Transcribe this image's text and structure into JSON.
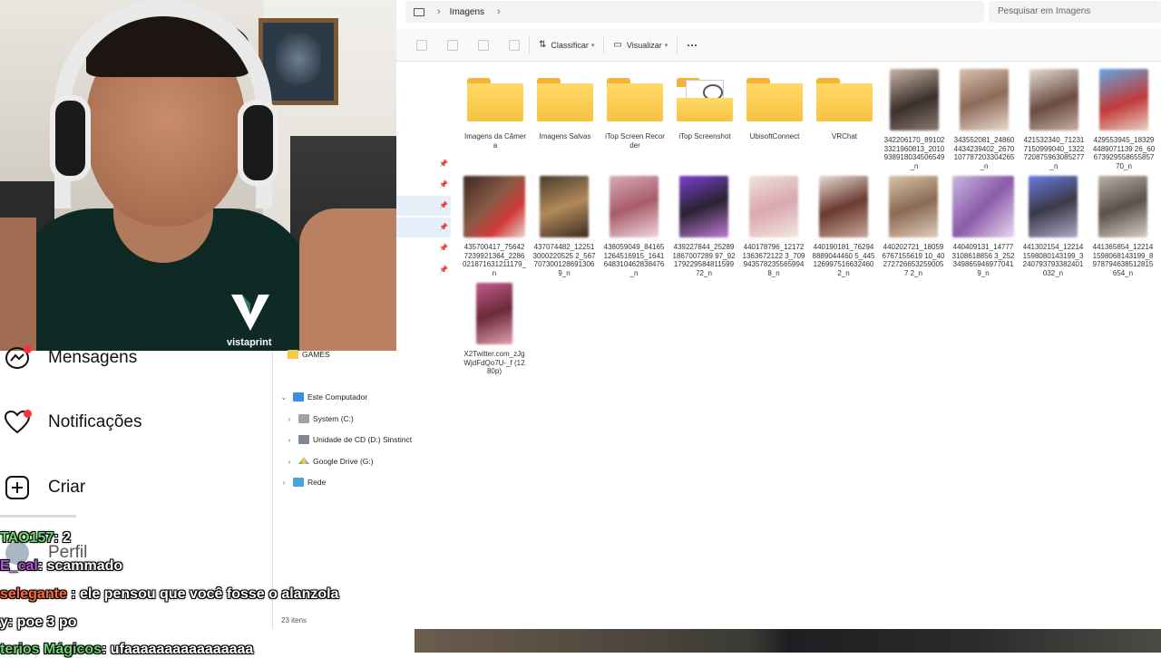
{
  "explorer": {
    "breadcrumb": "Imagens",
    "search_placeholder": "Pesquisar em Imagens",
    "toolbar": {
      "sort_label": "Classificar",
      "view_label": "Visualizar",
      "more_label": "···"
    },
    "status": "23 itens",
    "tree": [
      {
        "label": "GAMES",
        "icon": "folder-icon"
      },
      {
        "label": "Este Computador",
        "icon": "pc-icon",
        "expanded": true
      },
      {
        "label": "System  (C:)",
        "icon": "drive-icon"
      },
      {
        "label": "Unidade de CD (D:) Sinstinct",
        "icon": "cd-drive-icon"
      },
      {
        "label": "Google Drive (G:)",
        "icon": "google-drive-icon"
      },
      {
        "label": "Rede",
        "icon": "network-icon"
      }
    ],
    "folders": [
      {
        "name": "Imagens da Câmera"
      },
      {
        "name": "Imagens Salvas"
      },
      {
        "name": "iTop Screen Recorder"
      },
      {
        "name": "iTop Screenshot"
      },
      {
        "name": "UbisoftConnect"
      },
      {
        "name": "VRChat"
      }
    ],
    "files_row1": [
      {
        "name": "342206170_891023321960813_2010938918034506549_n"
      },
      {
        "name": "343552081_248604434239402_2670107787203304265_n"
      },
      {
        "name": "421532340_712317150999040_1322720875963085277_n"
      },
      {
        "name": "429553945_183294489071139 26_6067392955865585770_n"
      }
    ],
    "files_row2": [
      {
        "name": "435700417_756427239921364_2286021871631211179_n"
      },
      {
        "name": "437074482_122513000220525 2_567707300128691306 9_n"
      },
      {
        "name": "438059049_841651264516915_1641648310462838476_n"
      },
      {
        "name": "439227844_252891867007289 97_9217922958481159972_n"
      },
      {
        "name": "440178796_121721363672122 3_709943578235565994 8_n"
      },
      {
        "name": "440190181_762948889044460 5_445126997516632460 2_n"
      },
      {
        "name": "440202721_180596767155619 10_402727266532590057 2_n"
      },
      {
        "name": "440409131_147773108618856 3_252349865946977041 9_n"
      },
      {
        "name": "441302154_122141598080143199_3240793793382401032_n"
      },
      {
        "name": "441365854_122141598068143199_8978794638512815654_n"
      }
    ],
    "files_row3": [
      {
        "name": "X2Twitter.com_zJgWjdFdQo7U-_f (1280p)"
      }
    ]
  },
  "instagram_sidebar": {
    "items": [
      {
        "label": "Mensagens",
        "icon": "messenger-icon"
      },
      {
        "label": "Notificações",
        "icon": "heart-icon"
      },
      {
        "label": "Criar",
        "icon": "plus-square-icon"
      },
      {
        "label": "Perfil",
        "icon": "avatar"
      }
    ]
  },
  "chat": [
    {
      "user": "TAO157",
      "message": ": 2",
      "color": "#6bd66b"
    },
    {
      "user": "E_cal",
      "message": ": scammado",
      "color": "#b45ad8"
    },
    {
      "user": "selegante",
      "message": " : ele pensou que você fosse o alanzola",
      "color": "#ff6a3d"
    },
    {
      "user": "y",
      "message": ": poe 3 po",
      "color": "#ffffff"
    },
    {
      "user": "terios Mágicos",
      "message": ": ufaaaaaaaaaaaaaaaa",
      "color": "#6bd66b"
    }
  ],
  "webcam": {
    "shirt_brand": "vistaprint"
  },
  "colors": {
    "accent": "#0067c0",
    "folder": "#f6c343",
    "notification_dot": "#ff3040"
  }
}
